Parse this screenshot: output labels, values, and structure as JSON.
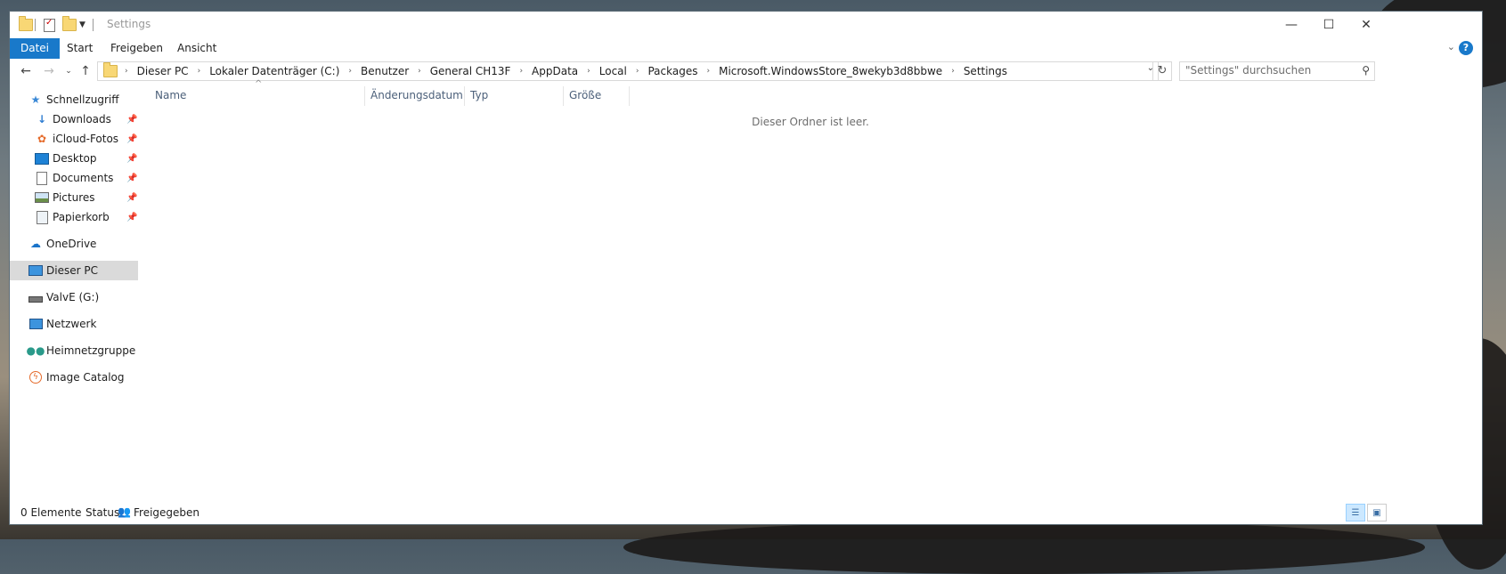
{
  "window": {
    "title": "Settings"
  },
  "ribbon": {
    "tabs": [
      {
        "label": "Datei",
        "active": true
      },
      {
        "label": "Start",
        "active": false
      },
      {
        "label": "Freigeben",
        "active": false
      },
      {
        "label": "Ansicht",
        "active": false
      }
    ]
  },
  "address": {
    "breadcrumbs": [
      "Dieser PC",
      "Lokaler Datenträger (C:)",
      "Benutzer",
      "General CH13F",
      "AppData",
      "Local",
      "Packages",
      "Microsoft.WindowsStore_8wekyb3d8bbwe",
      "Settings"
    ]
  },
  "search": {
    "placeholder": "\"Settings\" durchsuchen"
  },
  "nav": {
    "quick_access": "Schnellzugriff",
    "pinned": [
      {
        "label": "Downloads",
        "icon": "downloads-icon"
      },
      {
        "label": "iCloud-Fotos",
        "icon": "icloud-photos-icon"
      },
      {
        "label": "Desktop",
        "icon": "desktop-icon"
      },
      {
        "label": "Documents",
        "icon": "documents-icon"
      },
      {
        "label": "Pictures",
        "icon": "pictures-icon"
      },
      {
        "label": "Papierkorb",
        "icon": "recycle-bin-icon"
      }
    ],
    "onedrive": "OneDrive",
    "this_pc": "Dieser PC",
    "drive_g": "ValvE (G:)",
    "network": "Netzwerk",
    "homegroup": "Heimnetzgruppe",
    "image_catalog": "Image Catalog"
  },
  "columns": {
    "name": "Name",
    "date": "Änderungsdatum",
    "type": "Typ",
    "size": "Größe"
  },
  "content": {
    "empty_message": "Dieser Ordner ist leer."
  },
  "status": {
    "count": "0 Elemente",
    "label": "Status:",
    "value": "Freigegeben"
  },
  "colors": {
    "accent": "#1979ca",
    "selected_nav": "#dadada",
    "folder": "#f8d775"
  }
}
